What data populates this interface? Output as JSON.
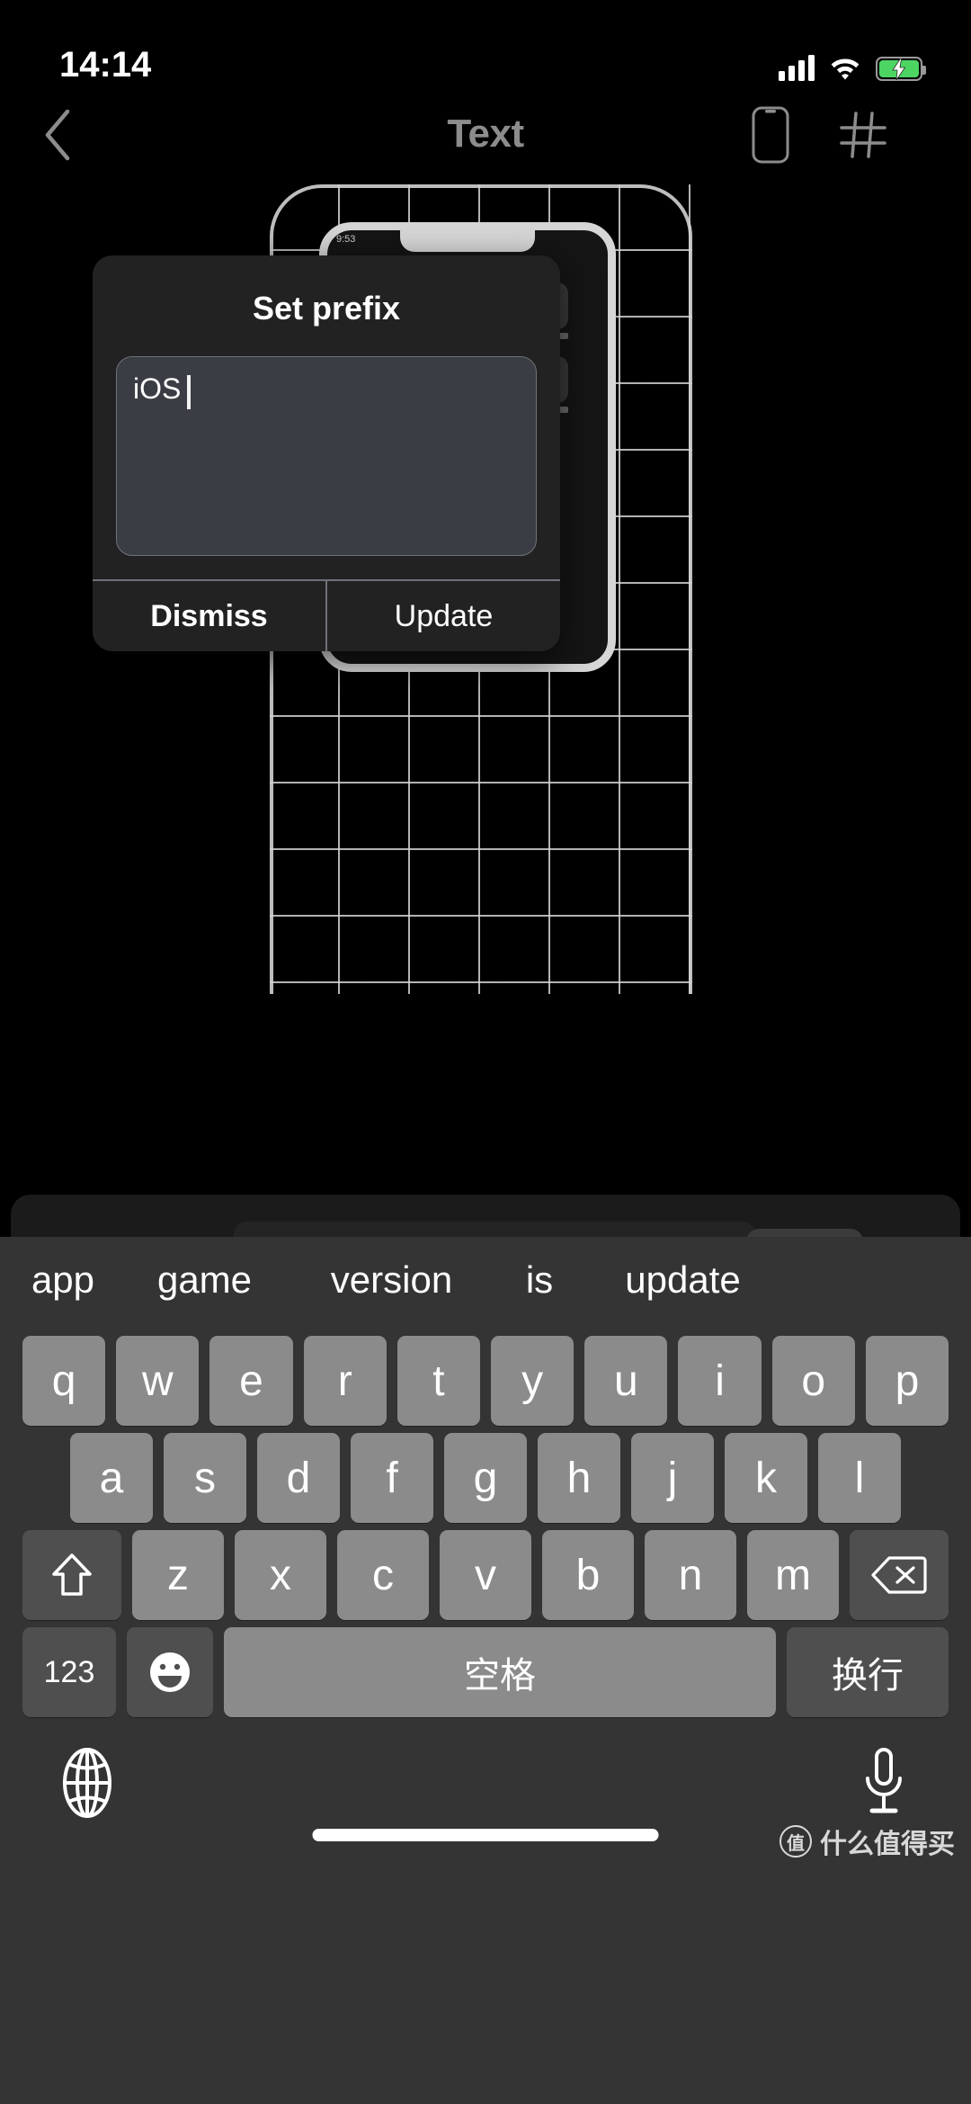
{
  "status_bar": {
    "time": "14:14",
    "cellular_icon": "cellular-bars-icon",
    "wifi_icon": "wifi-icon",
    "battery_icon": "battery-charging-icon",
    "battery_color": "#4cd562"
  },
  "nav_bar": {
    "back_icon": "chevron-left-icon",
    "title": "Text",
    "title_color": "#8c8c8c",
    "right_icons": [
      "phone-outline-icon",
      "grid-icon"
    ]
  },
  "dialog": {
    "title": "Set prefix",
    "input_value": "iOS",
    "input_placeholder": "",
    "dismiss_label": "Dismiss",
    "update_label": "Update",
    "background_color": "#222222",
    "input_background_color": "#3a3d44"
  },
  "keyboard": {
    "suggestions": [
      "app",
      "game",
      "version",
      "is",
      "update"
    ],
    "row1": [
      "q",
      "w",
      "e",
      "r",
      "t",
      "y",
      "u",
      "i",
      "o",
      "p"
    ],
    "row2": [
      "a",
      "s",
      "d",
      "f",
      "g",
      "h",
      "j",
      "k",
      "l"
    ],
    "row3_letters": [
      "z",
      "x",
      "c",
      "v",
      "b",
      "n",
      "m"
    ],
    "shift_icon": "shift-up-arrow-icon",
    "delete_icon": "backspace-delete-icon",
    "numbers_label": "123",
    "emoji_icon": "emoji-smiley-icon",
    "space_label": "空格",
    "return_label": "换行",
    "globe_icon": "globe-language-icon",
    "mic_icon": "microphone-dictation-icon",
    "key_color": "#8b8b8b",
    "modifier_key_color": "#4f4f4f",
    "keyboard_background": "#343434"
  },
  "watermark": {
    "logo_glyph": "值",
    "text": "什么值得买"
  }
}
